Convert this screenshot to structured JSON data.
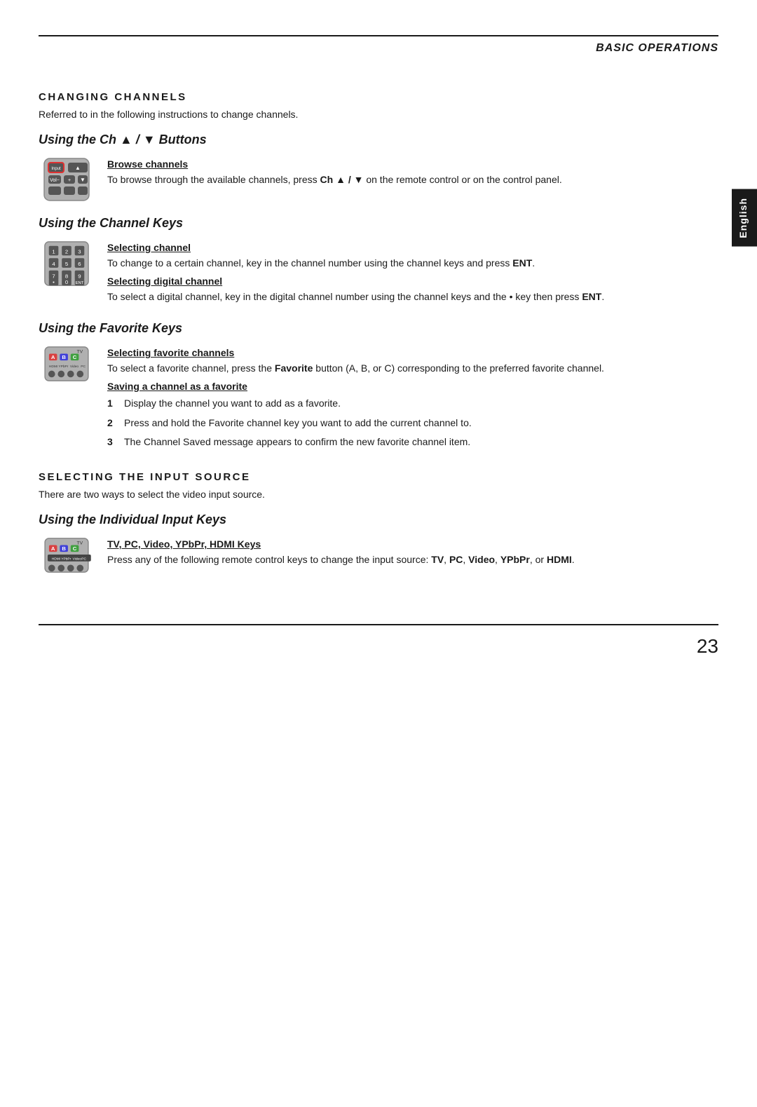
{
  "page": {
    "number": "23",
    "header": {
      "title": "BASIC OPERATIONS"
    }
  },
  "side_tab": {
    "label": "English"
  },
  "sections": {
    "changing_channels": {
      "heading": "CHANGING CHANNELS",
      "intro": "Referred to in the following instructions to change channels.",
      "subheadings": {
        "ch_buttons": {
          "title": "Using the Ch ▲ / ▼ Buttons",
          "browse": {
            "heading": "Browse channels",
            "text1": "To browse through the available channels, press ",
            "bold1": "Ch ▲ / ▼",
            "text2": " on the remote control or on the control panel."
          }
        },
        "channel_keys": {
          "title": "Using the Channel Keys",
          "selecting": {
            "heading": "Selecting channel",
            "text1": "To change to a certain channel, key in the channel number using the channel keys and press ",
            "bold1": "ENT",
            "text2": "."
          },
          "selecting_digital": {
            "heading": "Selecting digital channel",
            "text1": "To select a digital channel, key in the digital channel number using the channel keys and the • key then press ",
            "bold1": "ENT",
            "text2": "."
          }
        },
        "favorite_keys": {
          "title": "Using the Favorite Keys",
          "selecting_fav": {
            "heading": "Selecting favorite channels",
            "text1": "To select a favorite channel, press the ",
            "bold1": "Favorite",
            "text2": " button (A, B, or C) corresponding to the preferred favorite channel."
          },
          "saving_fav": {
            "heading": "Saving a channel as a favorite",
            "steps": [
              "Display the channel you want to add as a favorite.",
              "Press and hold the Favorite channel key you want to add the current channel to.",
              "The Channel Saved message appears to confirm the new favorite channel item."
            ]
          }
        }
      }
    },
    "selecting_input": {
      "heading": "SELECTING THE INPUT SOURCE",
      "intro": "There are two ways to select the video input source.",
      "subheadings": {
        "individual_keys": {
          "title": "Using the Individual Input Keys",
          "tv_keys": {
            "heading": "TV, PC, Video, YPbPr, HDMI Keys",
            "text1": "Press any of the following remote control keys to change the input source: ",
            "bold_items": [
              "TV",
              "PC",
              "Video",
              "YPbPr",
              "HDMI"
            ],
            "text2": "."
          }
        }
      }
    }
  }
}
